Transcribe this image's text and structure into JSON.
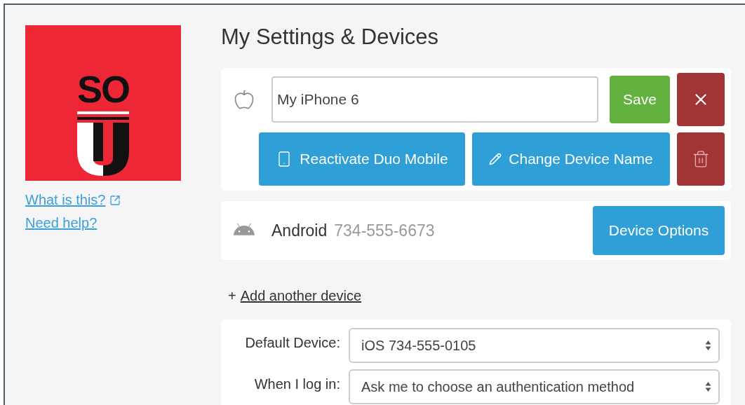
{
  "sidebar": {
    "logo": {
      "text": "SO"
    },
    "links": [
      {
        "label": "What is this?",
        "external": true
      },
      {
        "label": "Need help?",
        "external": false
      }
    ]
  },
  "title": "My Settings & Devices",
  "devices": [
    {
      "kind": "editing",
      "icon": {
        "kind": "apple"
      },
      "name_value": "My iPhone 6",
      "save_label": "Save",
      "reactivate_label": "Reactivate Duo Mobile",
      "change_label": "Change Device Name"
    },
    {
      "kind": "summary",
      "icon": {
        "kind": "android"
      },
      "name": "Android",
      "number": "734-555-6673",
      "options_label": "Device Options"
    }
  ],
  "add_device": {
    "prefix": "+",
    "label": "Add another device"
  },
  "settings": [
    {
      "label": "Default Device:",
      "value": "iOS 734-555-0105"
    },
    {
      "label": "When I log in:",
      "value": "Ask me to choose an authentication method"
    }
  ]
}
